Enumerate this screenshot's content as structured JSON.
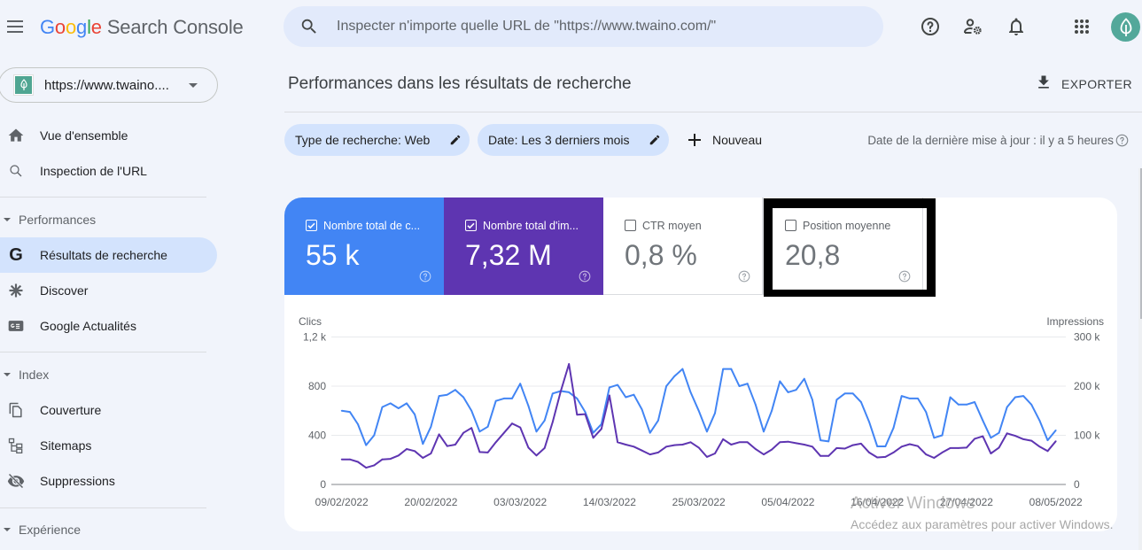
{
  "header": {
    "logo_brand_letters": [
      "G",
      "o",
      "o",
      "g",
      "l",
      "e"
    ],
    "logo_product": "Search Console",
    "search_placeholder": "Inspecter n'importe quelle URL de \"https://www.twaino.com/\"",
    "icons": [
      "help-icon",
      "admin-settings-icon",
      "notifications-icon",
      "apps-icon",
      "account-avatar"
    ]
  },
  "property": {
    "label": "https://www.twaino...."
  },
  "sidebar": {
    "overview": {
      "label": "Vue d'ensemble",
      "icon": "home-icon"
    },
    "url_inspection": {
      "label": "Inspection de l'URL",
      "icon": "search-icon"
    },
    "sections": [
      {
        "title": "Performances",
        "items": [
          {
            "label": "Résultats de recherche",
            "icon": "google-g-icon",
            "active": true
          },
          {
            "label": "Discover",
            "icon": "asterisk-icon"
          },
          {
            "label": "Google Actualités",
            "icon": "news-icon"
          }
        ]
      },
      {
        "title": "Index",
        "items": [
          {
            "label": "Couverture",
            "icon": "file-copy-icon"
          },
          {
            "label": "Sitemaps",
            "icon": "sitemap-icon"
          },
          {
            "label": "Suppressions",
            "icon": "visibility-off-icon"
          }
        ]
      },
      {
        "title": "Expérience",
        "items": []
      }
    ]
  },
  "main": {
    "title": "Performances dans les résultats de recherche",
    "export_label": "EXPORTER",
    "filters": [
      {
        "label": "Type de recherche: Web"
      },
      {
        "label": "Date: Les 3 derniers mois"
      }
    ],
    "new_label": "Nouveau",
    "last_update": "Date de la dernière mise à jour : il y a 5 heures"
  },
  "metrics": [
    {
      "label": "Nombre total de c...",
      "value": "55 k",
      "checked": true,
      "color": "#4285f4"
    },
    {
      "label": "Nombre total d'im...",
      "value": "7,32 M",
      "checked": true,
      "color": "#5e35b1"
    },
    {
      "label": "CTR moyen",
      "value": "0,8 %",
      "checked": false
    },
    {
      "label": "Position moyenne",
      "value": "20,8",
      "checked": false,
      "highlighted": true
    }
  ],
  "chart_data": {
    "type": "line",
    "title": "",
    "x": [
      "09/02/2022",
      "10/02/2022",
      "11/02/2022",
      "12/02/2022",
      "13/02/2022",
      "14/02/2022",
      "15/02/2022",
      "16/02/2022",
      "17/02/2022",
      "18/02/2022",
      "19/02/2022",
      "20/02/2022",
      "21/02/2022",
      "22/02/2022",
      "23/02/2022",
      "24/02/2022",
      "25/02/2022",
      "26/02/2022",
      "27/02/2022",
      "28/02/2022",
      "01/03/2022",
      "02/03/2022",
      "03/03/2022",
      "04/03/2022",
      "05/03/2022",
      "06/03/2022",
      "07/03/2022",
      "08/03/2022",
      "09/03/2022",
      "10/03/2022",
      "11/03/2022",
      "12/03/2022",
      "13/03/2022",
      "14/03/2022",
      "15/03/2022",
      "16/03/2022",
      "17/03/2022",
      "18/03/2022",
      "19/03/2022",
      "20/03/2022",
      "21/03/2022",
      "22/03/2022",
      "23/03/2022",
      "24/03/2022",
      "25/03/2022",
      "26/03/2022",
      "27/03/2022",
      "28/03/2022",
      "29/03/2022",
      "30/03/2022",
      "31/03/2022",
      "01/04/2022",
      "02/04/2022",
      "03/04/2022",
      "04/04/2022",
      "05/04/2022",
      "06/04/2022",
      "07/04/2022",
      "08/04/2022",
      "09/04/2022",
      "10/04/2022",
      "11/04/2022",
      "12/04/2022",
      "13/04/2022",
      "14/04/2022",
      "15/04/2022",
      "16/04/2022",
      "17/04/2022",
      "18/04/2022",
      "19/04/2022",
      "20/04/2022",
      "21/04/2022",
      "22/04/2022",
      "23/04/2022",
      "24/04/2022",
      "25/04/2022",
      "26/04/2022",
      "27/04/2022",
      "28/04/2022",
      "29/04/2022",
      "30/04/2022",
      "01/05/2022",
      "02/05/2022",
      "03/05/2022",
      "04/05/2022",
      "05/05/2022",
      "06/05/2022",
      "07/05/2022",
      "08/05/2022"
    ],
    "x_tick_labels": [
      "09/02/2022",
      "20/02/2022",
      "03/03/2022",
      "14/03/2022",
      "25/03/2022",
      "05/04/2022",
      "16/04/2022",
      "27/04/2022",
      "08/05/2022"
    ],
    "y_left": {
      "label": "Clics",
      "range": [
        0,
        1200
      ],
      "ticks": [
        0,
        400,
        800,
        1200
      ],
      "tick_labels": [
        "0",
        "400",
        "800",
        "1,2 k"
      ]
    },
    "y_right": {
      "label": "Impressions",
      "range": [
        0,
        300000
      ],
      "ticks": [
        0,
        100000,
        200000,
        300000
      ],
      "tick_labels": [
        "0",
        "100 k",
        "200 k",
        "300 k"
      ]
    },
    "series": [
      {
        "name": "Clics",
        "axis": "left",
        "color": "#4285f4",
        "values": [
          600,
          590,
          490,
          320,
          400,
          630,
          660,
          620,
          660,
          570,
          330,
          470,
          720,
          730,
          770,
          710,
          600,
          430,
          470,
          680,
          700,
          700,
          820,
          640,
          430,
          520,
          740,
          760,
          750,
          700,
          590,
          420,
          490,
          790,
          810,
          710,
          730,
          610,
          420,
          520,
          800,
          880,
          940,
          750,
          600,
          430,
          580,
          940,
          940,
          800,
          820,
          650,
          430,
          600,
          840,
          750,
          770,
          860,
          690,
          360,
          350,
          690,
          740,
          740,
          670,
          510,
          310,
          310,
          460,
          720,
          700,
          700,
          590,
          380,
          400,
          710,
          650,
          650,
          670,
          520,
          380,
          420,
          630,
          710,
          720,
          650,
          520,
          360,
          440
        ]
      },
      {
        "name": "Impressions",
        "axis": "right",
        "color": "#5e35b1",
        "values": [
          51000,
          51000,
          46000,
          34000,
          39000,
          51000,
          52000,
          59000,
          72000,
          68000,
          54000,
          63000,
          102000,
          78000,
          81000,
          105000,
          115000,
          66000,
          65000,
          86000,
          105000,
          124000,
          116000,
          75000,
          59000,
          74000,
          127000,
          190000,
          245000,
          142000,
          143000,
          95000,
          113000,
          181000,
          86000,
          81000,
          77000,
          69000,
          61000,
          65000,
          77000,
          80000,
          81000,
          86000,
          75000,
          56000,
          63000,
          92000,
          81000,
          86000,
          86000,
          72000,
          61000,
          71000,
          86000,
          87000,
          84000,
          81000,
          77000,
          58000,
          58000,
          74000,
          73000,
          80000,
          83000,
          65000,
          55000,
          56000,
          65000,
          77000,
          82000,
          78000,
          61000,
          54000,
          65000,
          74000,
          74000,
          75000,
          93000,
          98000,
          63000,
          75000,
          104000,
          99000,
          92000,
          89000,
          77000,
          68000,
          88000
        ]
      }
    ],
    "grid": true,
    "legend": "none"
  },
  "watermark": {
    "title": "Activer Windows",
    "subtitle": "Accédez aux paramètres pour activer Windows."
  }
}
